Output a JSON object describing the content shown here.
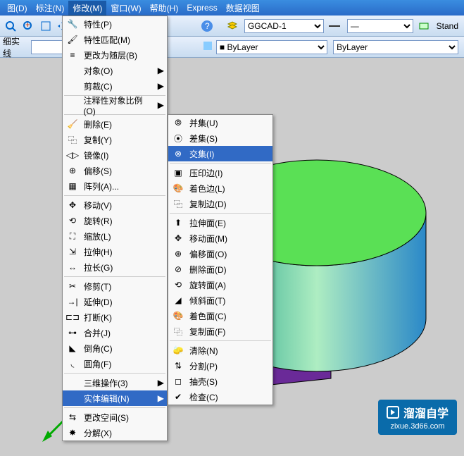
{
  "menubar": {
    "items": [
      "图(D)",
      "标注(N)",
      "修改(M)",
      "窗口(W)",
      "帮助(H)",
      "Express",
      "数据视图"
    ]
  },
  "toolbar1": {
    "layer_select": "GGCAD-1",
    "dash_select": "—",
    "style_btn": "Stand"
  },
  "toolbar2": {
    "linetype_label": "细实线",
    "color_select": "ByLayer",
    "lineweight_select": "ByLayer"
  },
  "modify_menu": {
    "items": [
      {
        "label": "特性(P)",
        "icon": "properties-icon"
      },
      {
        "label": "特性匹配(M)",
        "icon": "match-prop-icon"
      },
      {
        "label": "更改为随层(B)",
        "icon": "bylayer-icon"
      },
      {
        "label": "对象(O)",
        "icon": "",
        "submenu": true
      },
      {
        "label": "剪裁(C)",
        "icon": "",
        "submenu": true
      },
      {
        "label": "注释性对象比例(O)",
        "icon": "",
        "submenu": true
      },
      {
        "label": "删除(E)",
        "icon": "erase-icon"
      },
      {
        "label": "复制(Y)",
        "icon": "copy-icon"
      },
      {
        "label": "镜像(I)",
        "icon": "mirror-icon"
      },
      {
        "label": "偏移(S)",
        "icon": "offset-icon"
      },
      {
        "label": "阵列(A)...",
        "icon": "array-icon"
      },
      {
        "label": "移动(V)",
        "icon": "move-icon"
      },
      {
        "label": "旋转(R)",
        "icon": "rotate-icon"
      },
      {
        "label": "缩放(L)",
        "icon": "scale-icon"
      },
      {
        "label": "拉伸(H)",
        "icon": "stretch-icon"
      },
      {
        "label": "拉长(G)",
        "icon": "lengthen-icon"
      },
      {
        "label": "修剪(T)",
        "icon": "trim-icon"
      },
      {
        "label": "延伸(D)",
        "icon": "extend-icon"
      },
      {
        "label": "打断(K)",
        "icon": "break-icon"
      },
      {
        "label": "合并(J)",
        "icon": "join-icon"
      },
      {
        "label": "倒角(C)",
        "icon": "chamfer-icon"
      },
      {
        "label": "圆角(F)",
        "icon": "fillet-icon"
      },
      {
        "label": "三维操作(3)",
        "icon": "",
        "submenu": true
      },
      {
        "label": "实体编辑(N)",
        "icon": "",
        "submenu": true,
        "highlighted": true
      },
      {
        "label": "更改空间(S)",
        "icon": "chspace-icon"
      },
      {
        "label": "分解(X)",
        "icon": "explode-icon"
      }
    ]
  },
  "solid_edit_submenu": {
    "items": [
      {
        "label": "并集(U)",
        "icon": "union-icon"
      },
      {
        "label": "差集(S)",
        "icon": "subtract-icon"
      },
      {
        "label": "交集(I)",
        "icon": "intersect-icon",
        "highlighted": true
      },
      {
        "label": "压印边(I)",
        "icon": "imprint-icon"
      },
      {
        "label": "着色边(L)",
        "icon": "color-edge-icon"
      },
      {
        "label": "复制边(D)",
        "icon": "copy-edge-icon"
      },
      {
        "label": "拉伸面(E)",
        "icon": "extrude-face-icon"
      },
      {
        "label": "移动面(M)",
        "icon": "move-face-icon"
      },
      {
        "label": "偏移面(O)",
        "icon": "offset-face-icon"
      },
      {
        "label": "删除面(D)",
        "icon": "delete-face-icon"
      },
      {
        "label": "旋转面(A)",
        "icon": "rotate-face-icon"
      },
      {
        "label": "倾斜面(T)",
        "icon": "taper-face-icon"
      },
      {
        "label": "着色面(C)",
        "icon": "color-face-icon"
      },
      {
        "label": "复制面(F)",
        "icon": "copy-face-icon"
      },
      {
        "label": "清除(N)",
        "icon": "clean-icon"
      },
      {
        "label": "分割(P)",
        "icon": "separate-icon"
      },
      {
        "label": "抽壳(S)",
        "icon": "shell-icon"
      },
      {
        "label": "检查(C)",
        "icon": "check-icon"
      }
    ]
  },
  "watermark": {
    "brand": "溜溜自学",
    "url": "zixue.3d66.com"
  },
  "colors": {
    "menu_highlight": "#316ac5",
    "canvas_bg": "#cccccc",
    "cylinder_top": "#5ae055",
    "cylinder_side1": "#1ba890",
    "cylinder_side2": "#aeedc2",
    "box_top": "#d860e8",
    "box_side": "#7a3aa8"
  }
}
